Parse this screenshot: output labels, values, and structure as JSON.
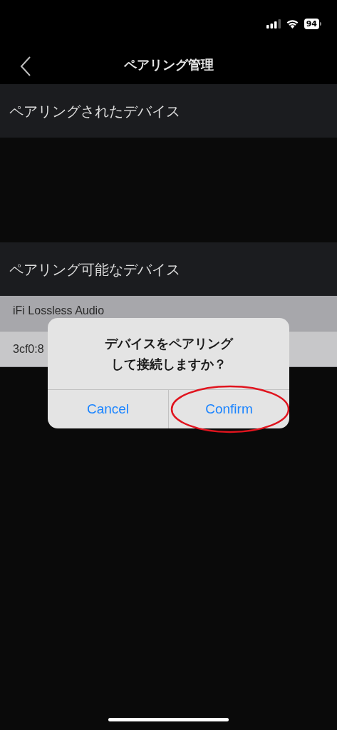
{
  "status_bar": {
    "battery": "94"
  },
  "nav": {
    "title": "ペアリング管理"
  },
  "paired_section": {
    "title": "ペアリングされたデバイス"
  },
  "available_section": {
    "title": "ペアリング可能なデバイス"
  },
  "available_devices": [
    {
      "name": "iFi Lossless Audio"
    },
    {
      "name": "3cf0:8"
    }
  ],
  "dialog": {
    "message_lines": [
      "デバイスをペアリング",
      "して接続しますか？"
    ],
    "buttons": [
      "Cancel",
      "Confirm"
    ]
  }
}
